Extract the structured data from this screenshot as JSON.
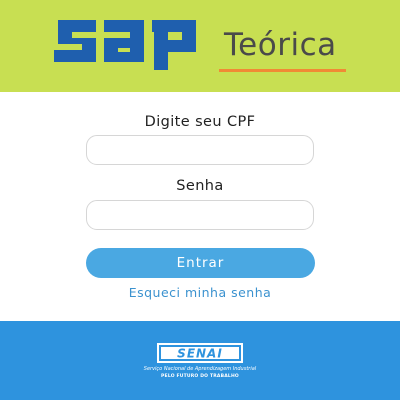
{
  "header": {
    "logo_text": "sap",
    "product_title": "Teórica",
    "colors": {
      "background": "#c8df52",
      "logo": "#1f5fae",
      "underline": "#f08a35"
    }
  },
  "form": {
    "cpf_label": "Digite seu CPF",
    "cpf_value": "",
    "password_label": "Senha",
    "password_value": "",
    "submit_label": "Entrar",
    "forgot_link": "Esqueci minha senha",
    "colors": {
      "button": "#4aa8e2",
      "link": "#3b92cf"
    }
  },
  "footer": {
    "brand": "SENAI",
    "tagline": "Serviço Nacional de Aprendizagem Industrial",
    "slogan": "PELO FUTURO DO TRABALHO",
    "colors": {
      "background": "#2e93de"
    }
  }
}
